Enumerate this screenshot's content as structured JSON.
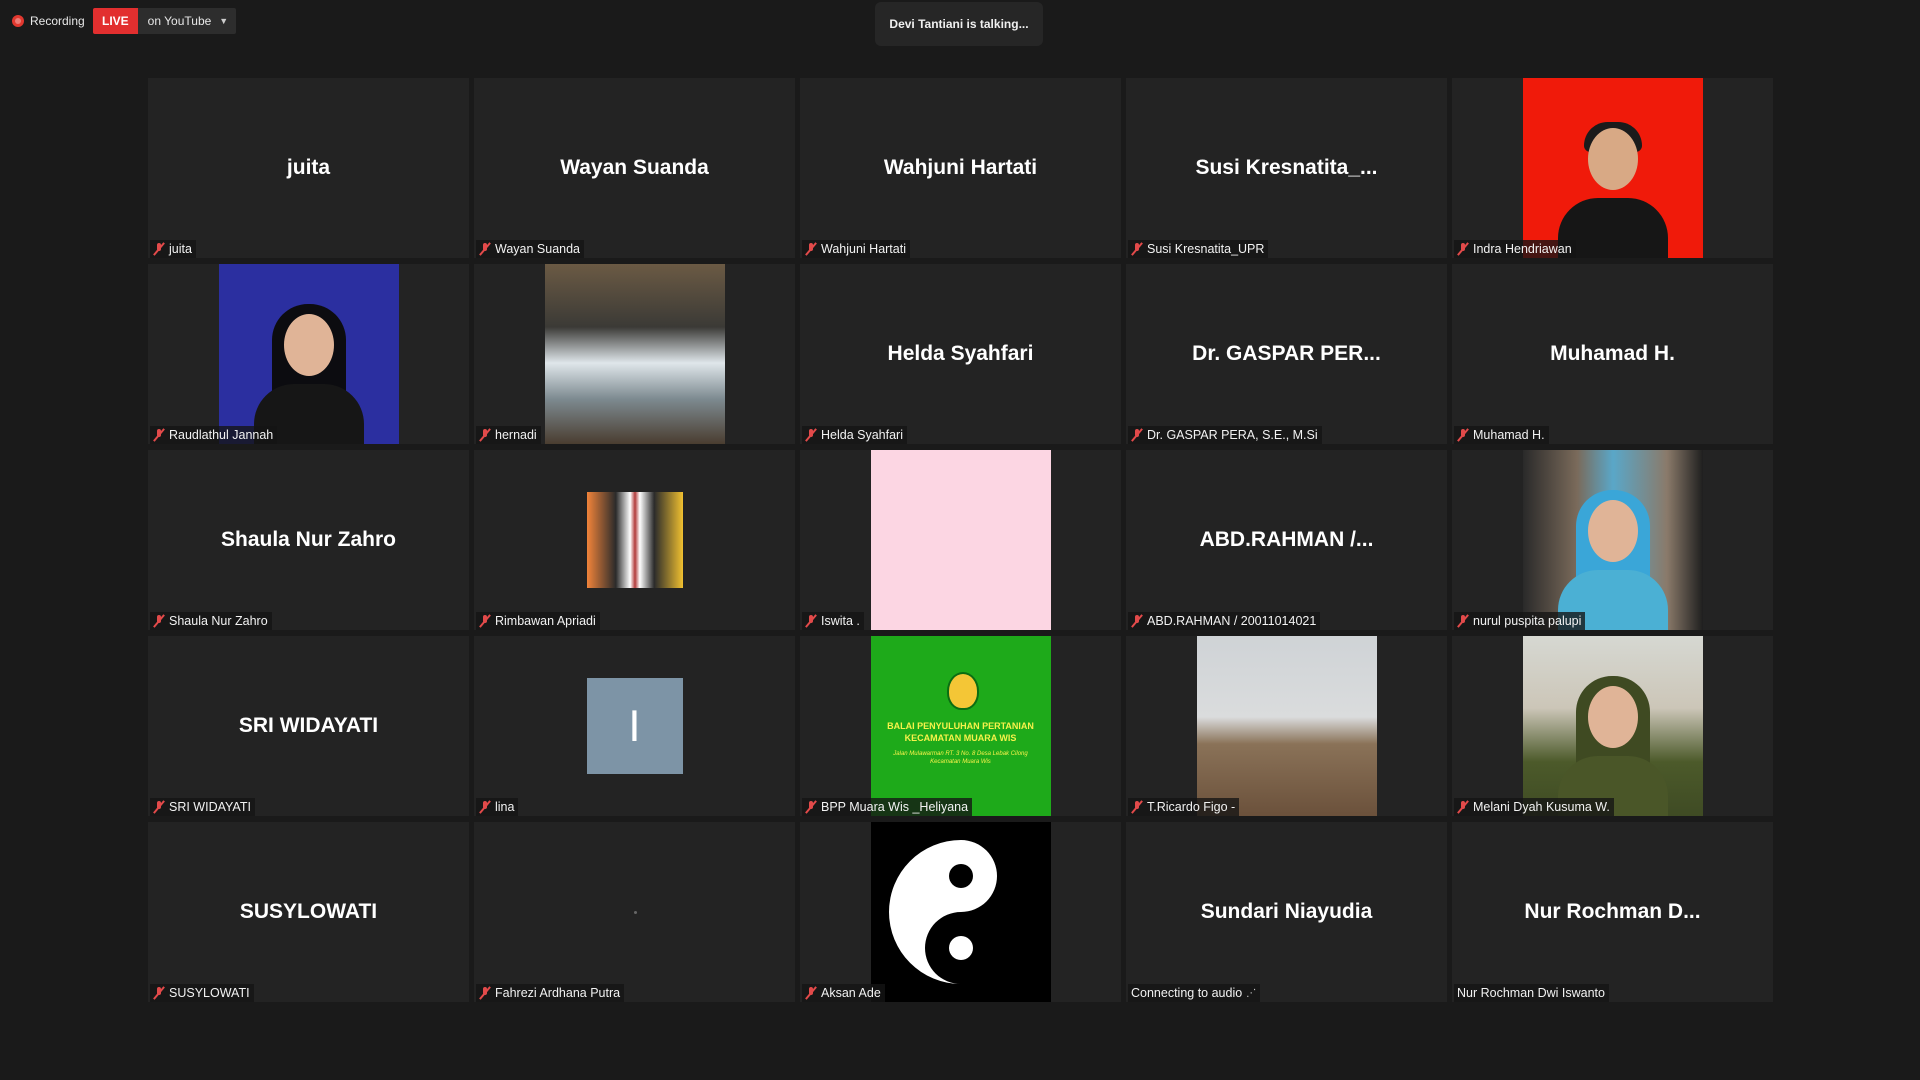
{
  "topbar": {
    "recording_label": "Recording",
    "live_badge": "LIVE",
    "live_destination": "on YouTube",
    "talking_indicator": "Devi Tantiani is talking..."
  },
  "tiles": [
    {
      "display": "juita",
      "label": "juita",
      "muted": true
    },
    {
      "display": "Wayan Suanda",
      "label": "Wayan Suanda",
      "muted": true
    },
    {
      "display": "Wahjuni Hartati",
      "label": "Wahjuni Hartati",
      "muted": true
    },
    {
      "display": "Susi  Kresnatita_...",
      "label": "Susi Kresnatita_UPR",
      "muted": true
    },
    {
      "display": "",
      "label": "Indra Hendriawan",
      "muted": true
    },
    {
      "display": "",
      "label": "Raudlathul Jannah",
      "muted": true
    },
    {
      "display": "",
      "label": "hernadi",
      "muted": true
    },
    {
      "display": "Helda Syahfari",
      "label": "Helda Syahfari",
      "muted": true
    },
    {
      "display": "Dr. GASPAR PER...",
      "label": "Dr. GASPAR PERA, S.E., M.Si",
      "muted": true
    },
    {
      "display": "Muhamad H.",
      "label": "Muhamad H.",
      "muted": true
    },
    {
      "display": "Shaula Nur Zahro",
      "label": "Shaula Nur Zahro",
      "muted": true
    },
    {
      "display": "",
      "label": "Rimbawan Apriadi",
      "muted": true
    },
    {
      "display": "",
      "label": "Iswita .",
      "muted": true
    },
    {
      "display": "ABD.RAHMAN  /...",
      "label": "ABD.RAHMAN / 20011014021",
      "muted": true
    },
    {
      "display": "",
      "label": "nurul puspita palupi",
      "muted": true
    },
    {
      "display": "SRI WIDAYATI",
      "label": "SRI WIDAYATI",
      "muted": true
    },
    {
      "display": "I",
      "label": "lina",
      "muted": true
    },
    {
      "display": "",
      "label": "BPP Muara Wis _Heliyana",
      "muted": true
    },
    {
      "display": "",
      "label": "T.Ricardo Figo -",
      "muted": true
    },
    {
      "display": "",
      "label": "Melani Dyah Kusuma W.",
      "muted": true
    },
    {
      "display": "SUSYLOWATI",
      "label": "SUSYLOWATI",
      "muted": true
    },
    {
      "display": "",
      "label": "Fahrezi Ardhana Putra",
      "muted": true
    },
    {
      "display": "",
      "label": "Aksan Ade",
      "muted": true
    },
    {
      "display": "Sundari Niayudia",
      "label": "Connecting to audio",
      "muted": false
    },
    {
      "display": "Nur Rochman  D...",
      "label": "Nur Rochman Dwi Iswanto",
      "muted": false
    }
  ],
  "bpp_logo": {
    "line1": "BALAI PENYULUHAN PERTANIAN",
    "line2": "KECAMATAN MUARA WIS",
    "address1": "Jalan Mulawarman RT. 3 No. 8 Desa Lebak Cilong",
    "address2": "Kecamatan Muara Wis"
  },
  "colors": {
    "background": "#1a1a1a",
    "tile": "#232323",
    "live": "#e22f2f",
    "muted_icon": "#e24a4a"
  }
}
